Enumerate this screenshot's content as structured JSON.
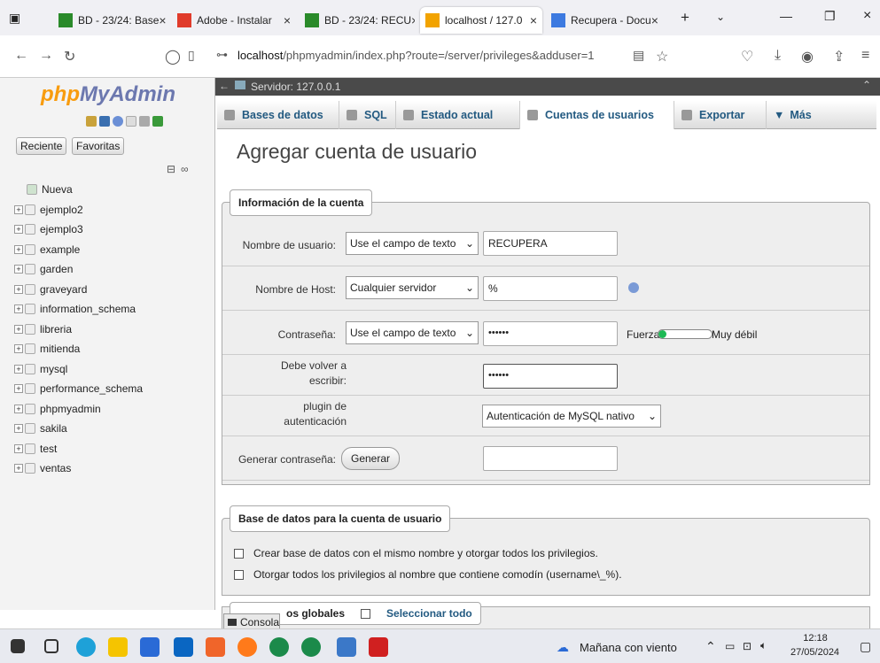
{
  "browser": {
    "tabs": [
      {
        "label": "BD - 23/24: Base",
        "color": "#2a8a2a"
      },
      {
        "label": "Adobe - Instalar",
        "color": "#e03b2b"
      },
      {
        "label": "BD - 23/24: RECU",
        "color": "#2a8a2a"
      },
      {
        "label": "localhost / 127.0",
        "color": "#f2a300"
      },
      {
        "label": "Recupera - Docu",
        "color": "#3d7ae0"
      }
    ],
    "url_host": "localhost",
    "url_path": "/phpmyadmin/index.php?route=/server/privileges&adduser=1"
  },
  "pma": {
    "logo_php": "php",
    "logo_my": "MyAdmin",
    "recent": "Reciente",
    "favorites": "Favoritas",
    "new_label": "Nueva",
    "databases": [
      "ejemplo2",
      "ejemplo3",
      "example",
      "garden",
      "graveyard",
      "information_schema",
      "libreria",
      "mitienda",
      "mysql",
      "performance_schema",
      "phpmyadmin",
      "sakila",
      "test",
      "ventas"
    ],
    "server": "Servidor: 127.0.0.1",
    "menu": [
      "Bases de datos",
      "SQL",
      "Estado actual",
      "Cuentas de usuarios",
      "Exportar",
      "Más"
    ],
    "page_title": "Agregar cuenta de usuario",
    "account_legend": "Información de la cuenta",
    "username_label": "Nombre de usuario:",
    "username_mode": "Use el campo de texto",
    "username_value": "RECUPERA",
    "host_label": "Nombre de Host:",
    "host_mode": "Cualquier servidor",
    "host_value": "%",
    "password_label": "Contraseña:",
    "password_mode": "Use el campo de texto",
    "password_value": "••••••",
    "strength_label": "Fuerza:",
    "strength_text": "Muy débil",
    "strength_level": 0.15,
    "retype_label_1": "Debe volver a",
    "retype_label_2": "escribir:",
    "retype_value": "••••••",
    "plugin_label_1": "plugin de",
    "plugin_label_2": "autenticación",
    "plugin_value": "Autenticación de MySQL nativo",
    "generate_label": "Generar contraseña:",
    "generate_button": "Generar",
    "db_legend": "Base de datos para la cuenta de usuario",
    "db_option_1": "Crear base de datos con el mismo nombre y otorgar todos los privilegios.",
    "db_option_2": "Otorgar todos los privilegios al nombre que contiene comodín (username\\_%).",
    "console": "Consola",
    "global_priv": "os globales",
    "select_all": "Seleccionar todo"
  },
  "taskbar": {
    "weather": "Mañana con viento",
    "time": "12:18",
    "date": "27/05/2024"
  }
}
